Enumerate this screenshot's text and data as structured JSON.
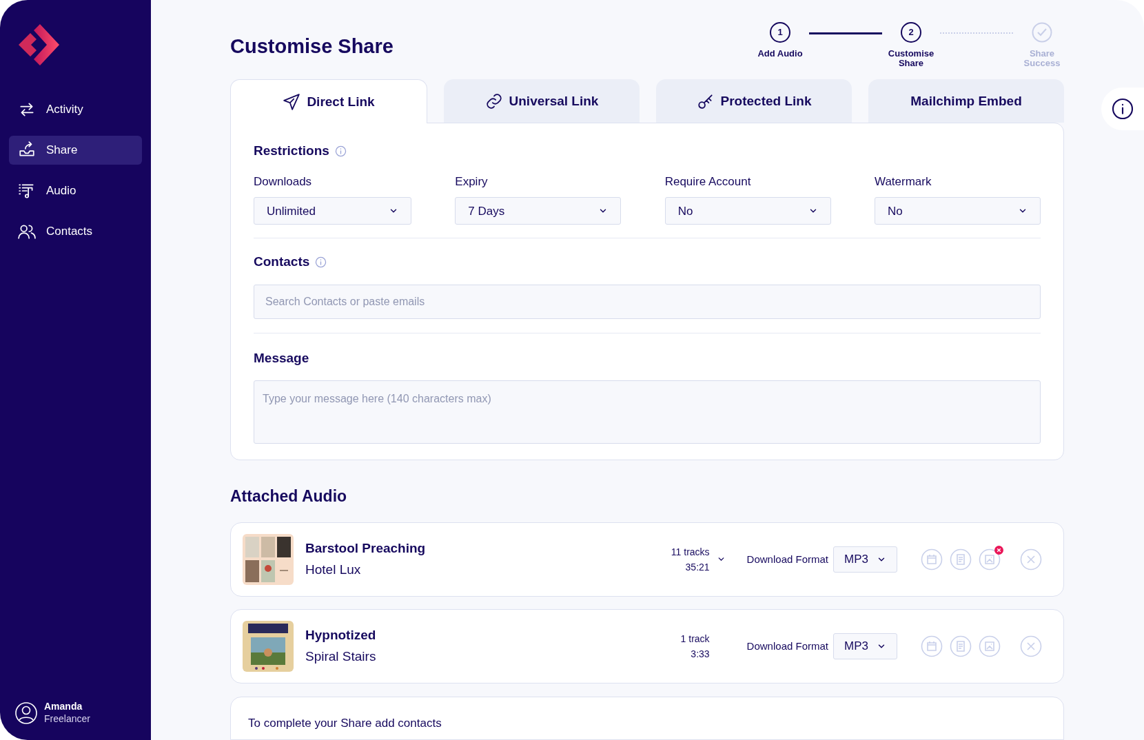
{
  "sidebar": {
    "items": [
      {
        "label": "Activity",
        "selected": false
      },
      {
        "label": "Share",
        "selected": true
      },
      {
        "label": "Audio",
        "selected": false
      },
      {
        "label": "Contacts",
        "selected": false
      }
    ],
    "user": {
      "name": "Amanda",
      "role": "Freelancer"
    }
  },
  "page_title": "Customise Share",
  "steps": [
    {
      "number": "1",
      "label": "Add Audio",
      "selected": false,
      "disabled": false
    },
    {
      "number": "2",
      "label": "Customise Share",
      "selected": true,
      "disabled": false
    },
    {
      "label": "Share Success",
      "selected": false,
      "disabled": true
    }
  ],
  "tabs": [
    {
      "label": "Direct Link",
      "selected": true
    },
    {
      "label": "Universal Link",
      "selected": false
    },
    {
      "label": "Protected Link",
      "selected": false
    },
    {
      "label": "Mailchimp Embed",
      "selected": false
    }
  ],
  "restrictions": {
    "title": "Restrictions",
    "fields": [
      {
        "label": "Downloads",
        "value": "Unlimited"
      },
      {
        "label": "Expiry",
        "value": "7 Days"
      },
      {
        "label": "Require Account",
        "value": "No"
      },
      {
        "label": "Watermark",
        "value": "No"
      }
    ]
  },
  "contacts": {
    "title": "Contacts",
    "placeholder": "Search Contacts or paste emails"
  },
  "message": {
    "title": "Message",
    "placeholder": "Type your message here (140 characters max)"
  },
  "attached_audio": {
    "title": "Attached Audio",
    "items": [
      {
        "title": "Barstool Preaching",
        "artist": "Hotel Lux",
        "tracks": "11 tracks",
        "duration": "35:21",
        "expandable": true,
        "format_label": "Download Format",
        "format": "MP3",
        "artwork_missing": true
      },
      {
        "title": "Hypnotized",
        "artist": "Spiral Stairs",
        "tracks": "1 track",
        "duration": "3:33",
        "expandable": false,
        "format_label": "Download Format",
        "format": "MP3",
        "artwork_missing": false
      }
    ]
  },
  "footer_note": "To complete your Share add contacts"
}
